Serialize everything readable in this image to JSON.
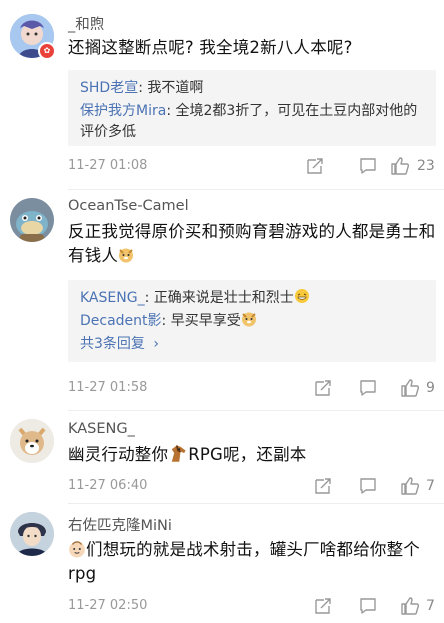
{
  "comments": [
    {
      "username": "_和煦",
      "text": "还搁这整断点呢? 我全境2新八人本呢?",
      "replies": [
        {
          "name": "SHD老宣",
          "sep": ": ",
          "text": "我不道啊"
        },
        {
          "name": "保护我方Mira",
          "sep": ": ",
          "text": "全境2都3折了，可见在土豆内部对他的评价多低"
        }
      ],
      "time": "11-27 01:08",
      "likes": "23",
      "vip_badge": "✿"
    },
    {
      "username": "OceanTse-Camel",
      "text": "反正我觉得原价买和预购育碧游戏的人都是勇士和有钱人",
      "replies": [
        {
          "name": "KASENG_",
          "sep": ": ",
          "text": "正确来说是壮士和烈士"
        },
        {
          "name": "Decadent影",
          "sep": ": ",
          "text": "早买早享受"
        }
      ],
      "more_replies": "共3条回复",
      "more_chevron": "›",
      "time": "11-27 01:58",
      "likes": "9"
    },
    {
      "username": "KASENG_",
      "text_before": "幽灵行动整你",
      "text_after": "RPG呢，还副本",
      "time": "11-27 06:40",
      "likes": "7"
    },
    {
      "username": "右佐匹克隆MiNi",
      "text_after": "们想玩的就是战术射击，罐头厂啥都给你整个rpg",
      "time": "11-27 02:50",
      "likes": "7"
    }
  ],
  "icons": {
    "share": "share-icon",
    "comment": "comment-icon",
    "like": "thumbs-up-icon",
    "emoji_doge": "doge-emoji",
    "emoji_laugh": "laugh-emoji",
    "emoji_horse": "horse-emoji",
    "emoji_baby": "baby-emoji"
  },
  "colors": {
    "link": "#4b73b3",
    "meta": "#999999",
    "reply_bg": "#f4f4f5",
    "vip": "#e9423a"
  }
}
